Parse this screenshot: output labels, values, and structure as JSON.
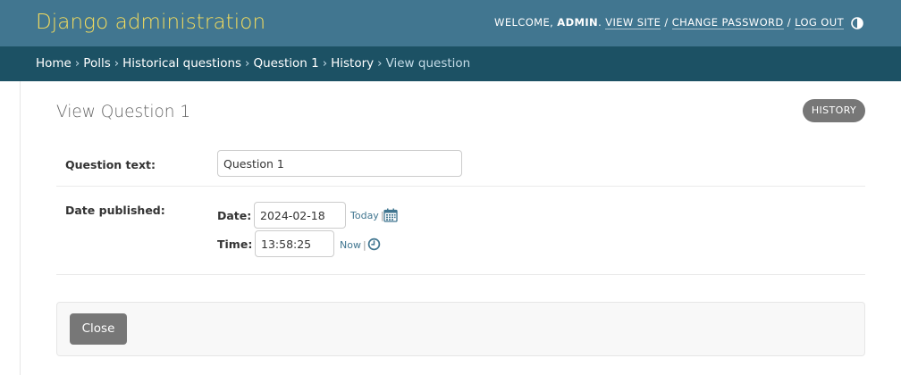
{
  "header": {
    "branding": "Django administration",
    "welcome": "Welcome,",
    "username": "admin",
    "view_site": "View site",
    "change_password": "Change password",
    "log_out": "Log out",
    "sep1": ".",
    "sep2": "/",
    "sep3": "/"
  },
  "breadcrumbs": {
    "items": [
      "Home",
      "Polls",
      "Historical questions",
      "Question 1",
      "History"
    ],
    "current": "View question",
    "separator": "›"
  },
  "page": {
    "title": "View Question 1",
    "history_button": "History"
  },
  "form": {
    "question_text": {
      "label": "Question text:",
      "value": "Question 1"
    },
    "date_published": {
      "label": "Date published:",
      "date_label": "Date:",
      "date_value": "2024-02-18",
      "today_link": "Today",
      "time_label": "Time:",
      "time_value": "13:58:25",
      "now_link": "Now",
      "bar": "|"
    }
  },
  "actions": {
    "close_button": "Close"
  },
  "icons": {
    "theme_toggle": "half-circle-icon",
    "calendar": "calendar-icon",
    "clock": "clock-icon"
  },
  "colors": {
    "header_bg": "#417690",
    "branding": "#f5dd5d",
    "breadcrumbs_bg": "#1c5164",
    "link": "#417690",
    "button_bg": "#777777"
  }
}
